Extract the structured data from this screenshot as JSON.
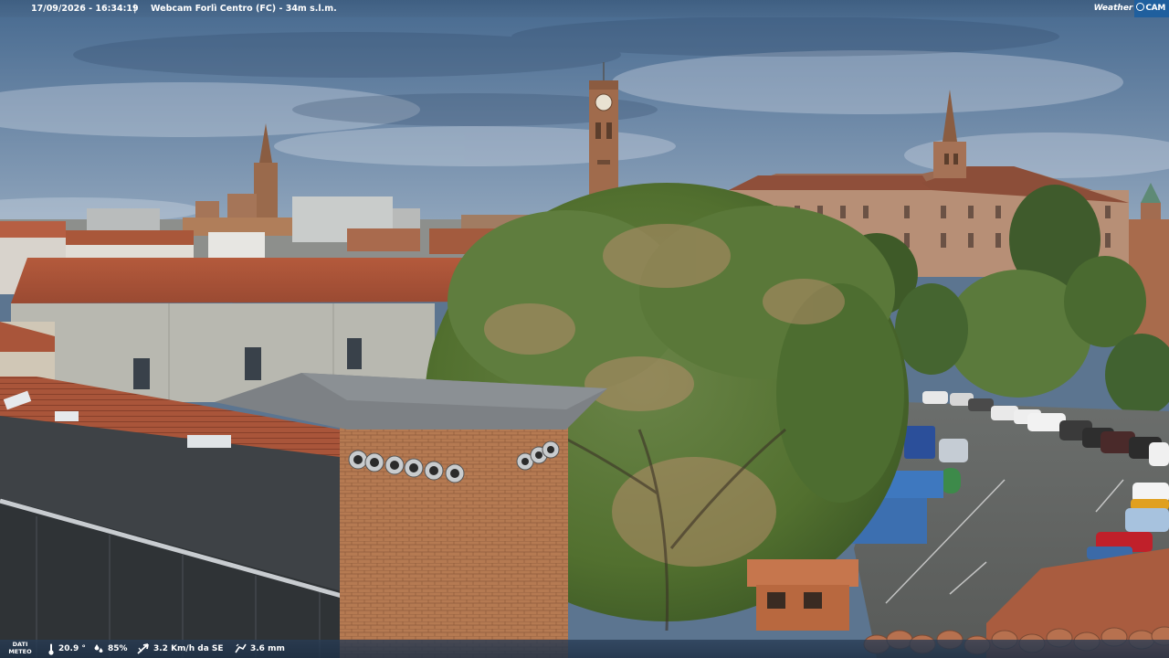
{
  "header": {
    "datetime": "17/09/2026 - 16:34:19",
    "separator": "|",
    "location": "Webcam Forlì Centro (FC) - 34m s.l.m."
  },
  "logo": {
    "weather": "Weather",
    "cam": "CAM"
  },
  "footer": {
    "label_line1": "DATI",
    "label_line2": "METEO",
    "temperature": "20.9 °",
    "humidity": "85%",
    "wind": "3.2 Km/h da SE",
    "rain": "3.6 mm"
  },
  "colors": {
    "sky": "#5b7896",
    "roof_terracotta": "#b0563a",
    "tree_green": "#4e6f35",
    "bar_blue": "#3f5f82",
    "logo_blue": "#1f5f9e"
  }
}
